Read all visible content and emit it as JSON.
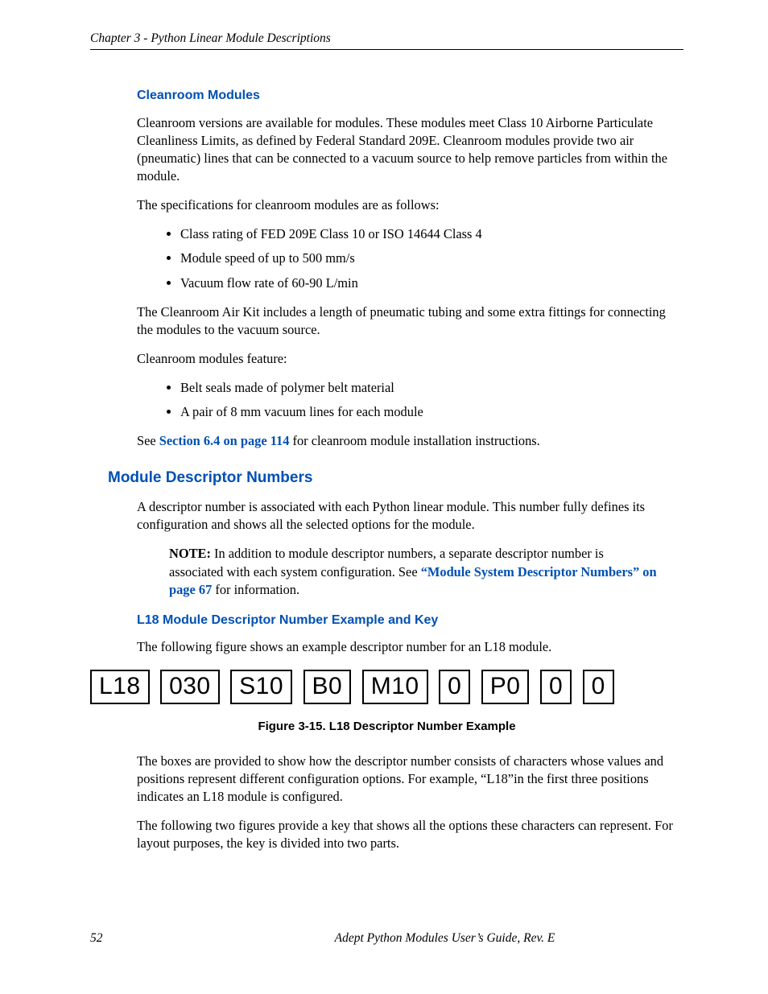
{
  "header": {
    "chapter_line": "Chapter 3 - Python Linear Module Descriptions"
  },
  "sec_cleanroom": {
    "title": "Cleanroom Modules",
    "p1": "Cleanroom versions are available for modules. These modules meet Class 10 Airborne Particulate Cleanliness Limits, as defined by Federal Standard 209E. Cleanroom modules provide two air (pneumatic) lines that can be connected to a vacuum source to help remove particles from within the module.",
    "p2": "The specifications for cleanroom modules are as follows:",
    "specs": [
      "Class rating of FED 209E Class 10 or ISO 14644 Class 4",
      "Module speed of up to 500 mm/s",
      "Vacuum flow rate of 60-90 L/min"
    ],
    "p3": "The Cleanroom Air Kit includes a length of pneumatic tubing and some extra fittings for connecting the modules to the vacuum source.",
    "p4": "Cleanroom modules feature:",
    "features": [
      "Belt seals made of polymer belt material",
      "A pair of 8 mm vacuum lines for each module"
    ],
    "p5_prefix": "See ",
    "p5_link": "Section 6.4 on page 114",
    "p5_suffix": " for cleanroom module installation instructions."
  },
  "sec_descriptor": {
    "title": "Module Descriptor Numbers",
    "p1": "A descriptor number is associated with each Python linear module. This number fully defines its configuration and shows all the selected options for the module.",
    "note_label": "NOTE:",
    "note_body_prefix": " In addition to module descriptor numbers, a separate descriptor number is associated with each system configuration. See ",
    "note_link": "“Module System Descriptor Numbers” on page 67",
    "note_body_suffix": " for information.",
    "sub_title": "L18 Module Descriptor Number Example and Key",
    "p2": "The following figure shows an example descriptor number for an L18 module.",
    "boxes": [
      "L18",
      "030",
      "S10",
      "B0",
      "M10",
      "0",
      "P0",
      "0",
      "0"
    ],
    "fig_caption": "Figure 3-15. L18 Descriptor Number Example",
    "p3": "The boxes are provided to show how the descriptor number consists of characters whose values and positions represent different configuration options. For example, “L18”in the first three positions indicates an L18 module is configured.",
    "p4": "The following two figures provide a key that shows all the options these characters can represent. For layout purposes, the key is divided into two parts."
  },
  "footer": {
    "page_number": "52",
    "title": "Adept Python Modules User’s Guide, Rev. E"
  }
}
